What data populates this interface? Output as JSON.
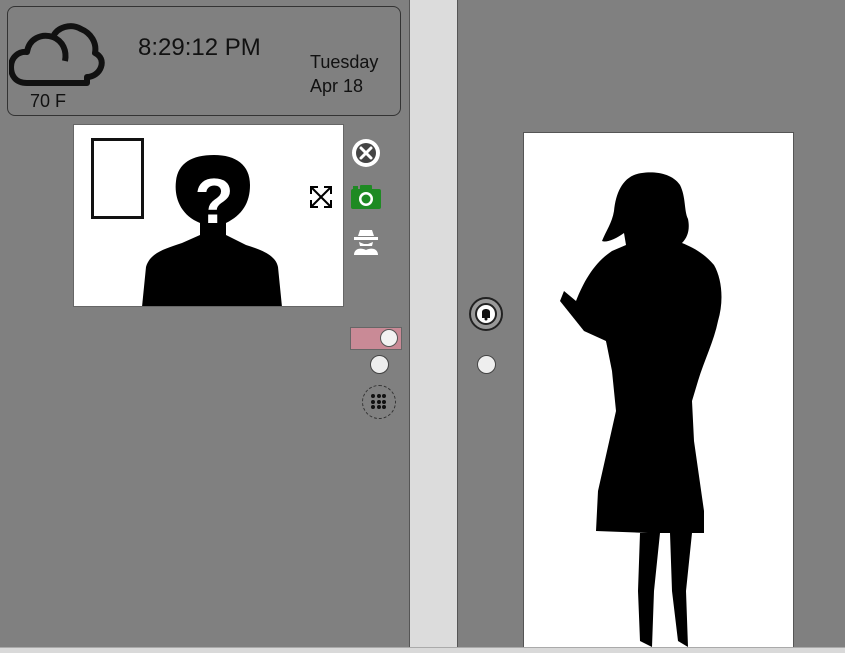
{
  "status": {
    "temperature": "70 F",
    "time": "8:29:12 PM",
    "day": "Tuesday",
    "date": "Apr 18",
    "weather_icon": "cloud-icon"
  },
  "controls": {
    "icons": [
      "close-icon",
      "camera-icon",
      "spy-icon",
      "expand-icon",
      "keypad-icon",
      "doorbell-icon"
    ],
    "toggle_state": "on",
    "colors": {
      "toggle": "#c98a96",
      "camera": "#1e8a23"
    }
  }
}
